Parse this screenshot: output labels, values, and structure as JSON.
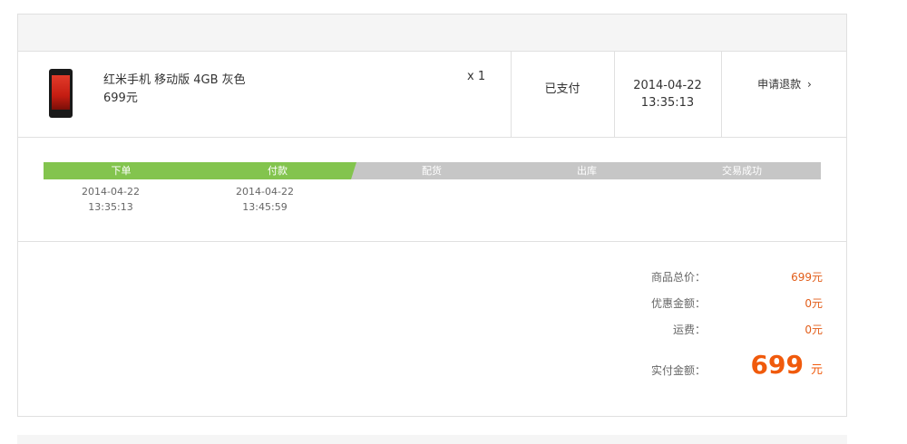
{
  "order": {
    "product_name": "红米手机 移动版 4GB 灰色",
    "product_price": "699元",
    "quantity": "x 1",
    "pay_status": "已支付",
    "order_date": "2014-04-22",
    "order_time": "13:35:13",
    "refund_label": "申请退款",
    "refund_arrow": "›"
  },
  "progress": {
    "steps": [
      {
        "label": "下单",
        "date": "2014-04-22",
        "time": "13:35:13",
        "done": true
      },
      {
        "label": "付款",
        "date": "2014-04-22",
        "time": "13:45:59",
        "done": true
      },
      {
        "label": "配货",
        "date": "",
        "time": "",
        "done": false
      },
      {
        "label": "出库",
        "date": "",
        "time": "",
        "done": false
      },
      {
        "label": "交易成功",
        "date": "",
        "time": "",
        "done": false
      }
    ],
    "done_color": "#83c44e",
    "pending_color": "#c6c6c6"
  },
  "summary": {
    "subtotal_label": "商品总价：",
    "subtotal_value": "699元",
    "discount_label": "优惠金额：",
    "discount_value": "0元",
    "shipping_label": "运费：",
    "shipping_value": "0元",
    "total_label": "实付金额：",
    "total_amount": "699",
    "total_unit": "元"
  },
  "colors": {
    "accent_orange": "#f05a0c",
    "border": "#e0e0e0"
  }
}
